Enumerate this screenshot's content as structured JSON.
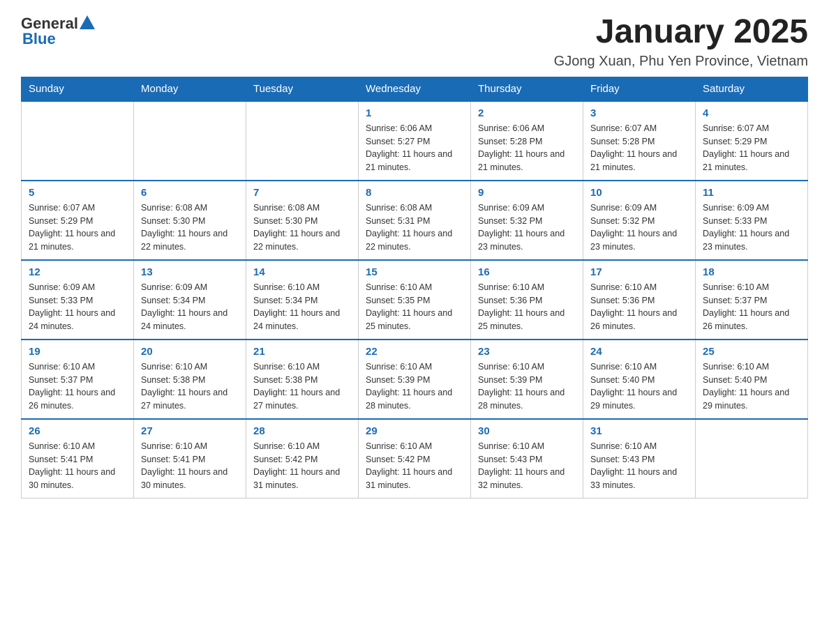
{
  "header": {
    "logo": {
      "general": "General",
      "blue": "Blue"
    },
    "title": "January 2025",
    "location": "GJong Xuan, Phu Yen Province, Vietnam"
  },
  "days_of_week": [
    "Sunday",
    "Monday",
    "Tuesday",
    "Wednesday",
    "Thursday",
    "Friday",
    "Saturday"
  ],
  "weeks": [
    [
      {
        "num": "",
        "info": ""
      },
      {
        "num": "",
        "info": ""
      },
      {
        "num": "",
        "info": ""
      },
      {
        "num": "1",
        "info": "Sunrise: 6:06 AM\nSunset: 5:27 PM\nDaylight: 11 hours and 21 minutes."
      },
      {
        "num": "2",
        "info": "Sunrise: 6:06 AM\nSunset: 5:28 PM\nDaylight: 11 hours and 21 minutes."
      },
      {
        "num": "3",
        "info": "Sunrise: 6:07 AM\nSunset: 5:28 PM\nDaylight: 11 hours and 21 minutes."
      },
      {
        "num": "4",
        "info": "Sunrise: 6:07 AM\nSunset: 5:29 PM\nDaylight: 11 hours and 21 minutes."
      }
    ],
    [
      {
        "num": "5",
        "info": "Sunrise: 6:07 AM\nSunset: 5:29 PM\nDaylight: 11 hours and 21 minutes."
      },
      {
        "num": "6",
        "info": "Sunrise: 6:08 AM\nSunset: 5:30 PM\nDaylight: 11 hours and 22 minutes."
      },
      {
        "num": "7",
        "info": "Sunrise: 6:08 AM\nSunset: 5:30 PM\nDaylight: 11 hours and 22 minutes."
      },
      {
        "num": "8",
        "info": "Sunrise: 6:08 AM\nSunset: 5:31 PM\nDaylight: 11 hours and 22 minutes."
      },
      {
        "num": "9",
        "info": "Sunrise: 6:09 AM\nSunset: 5:32 PM\nDaylight: 11 hours and 23 minutes."
      },
      {
        "num": "10",
        "info": "Sunrise: 6:09 AM\nSunset: 5:32 PM\nDaylight: 11 hours and 23 minutes."
      },
      {
        "num": "11",
        "info": "Sunrise: 6:09 AM\nSunset: 5:33 PM\nDaylight: 11 hours and 23 minutes."
      }
    ],
    [
      {
        "num": "12",
        "info": "Sunrise: 6:09 AM\nSunset: 5:33 PM\nDaylight: 11 hours and 24 minutes."
      },
      {
        "num": "13",
        "info": "Sunrise: 6:09 AM\nSunset: 5:34 PM\nDaylight: 11 hours and 24 minutes."
      },
      {
        "num": "14",
        "info": "Sunrise: 6:10 AM\nSunset: 5:34 PM\nDaylight: 11 hours and 24 minutes."
      },
      {
        "num": "15",
        "info": "Sunrise: 6:10 AM\nSunset: 5:35 PM\nDaylight: 11 hours and 25 minutes."
      },
      {
        "num": "16",
        "info": "Sunrise: 6:10 AM\nSunset: 5:36 PM\nDaylight: 11 hours and 25 minutes."
      },
      {
        "num": "17",
        "info": "Sunrise: 6:10 AM\nSunset: 5:36 PM\nDaylight: 11 hours and 26 minutes."
      },
      {
        "num": "18",
        "info": "Sunrise: 6:10 AM\nSunset: 5:37 PM\nDaylight: 11 hours and 26 minutes."
      }
    ],
    [
      {
        "num": "19",
        "info": "Sunrise: 6:10 AM\nSunset: 5:37 PM\nDaylight: 11 hours and 26 minutes."
      },
      {
        "num": "20",
        "info": "Sunrise: 6:10 AM\nSunset: 5:38 PM\nDaylight: 11 hours and 27 minutes."
      },
      {
        "num": "21",
        "info": "Sunrise: 6:10 AM\nSunset: 5:38 PM\nDaylight: 11 hours and 27 minutes."
      },
      {
        "num": "22",
        "info": "Sunrise: 6:10 AM\nSunset: 5:39 PM\nDaylight: 11 hours and 28 minutes."
      },
      {
        "num": "23",
        "info": "Sunrise: 6:10 AM\nSunset: 5:39 PM\nDaylight: 11 hours and 28 minutes."
      },
      {
        "num": "24",
        "info": "Sunrise: 6:10 AM\nSunset: 5:40 PM\nDaylight: 11 hours and 29 minutes."
      },
      {
        "num": "25",
        "info": "Sunrise: 6:10 AM\nSunset: 5:40 PM\nDaylight: 11 hours and 29 minutes."
      }
    ],
    [
      {
        "num": "26",
        "info": "Sunrise: 6:10 AM\nSunset: 5:41 PM\nDaylight: 11 hours and 30 minutes."
      },
      {
        "num": "27",
        "info": "Sunrise: 6:10 AM\nSunset: 5:41 PM\nDaylight: 11 hours and 30 minutes."
      },
      {
        "num": "28",
        "info": "Sunrise: 6:10 AM\nSunset: 5:42 PM\nDaylight: 11 hours and 31 minutes."
      },
      {
        "num": "29",
        "info": "Sunrise: 6:10 AM\nSunset: 5:42 PM\nDaylight: 11 hours and 31 minutes."
      },
      {
        "num": "30",
        "info": "Sunrise: 6:10 AM\nSunset: 5:43 PM\nDaylight: 11 hours and 32 minutes."
      },
      {
        "num": "31",
        "info": "Sunrise: 6:10 AM\nSunset: 5:43 PM\nDaylight: 11 hours and 33 minutes."
      },
      {
        "num": "",
        "info": ""
      }
    ]
  ]
}
